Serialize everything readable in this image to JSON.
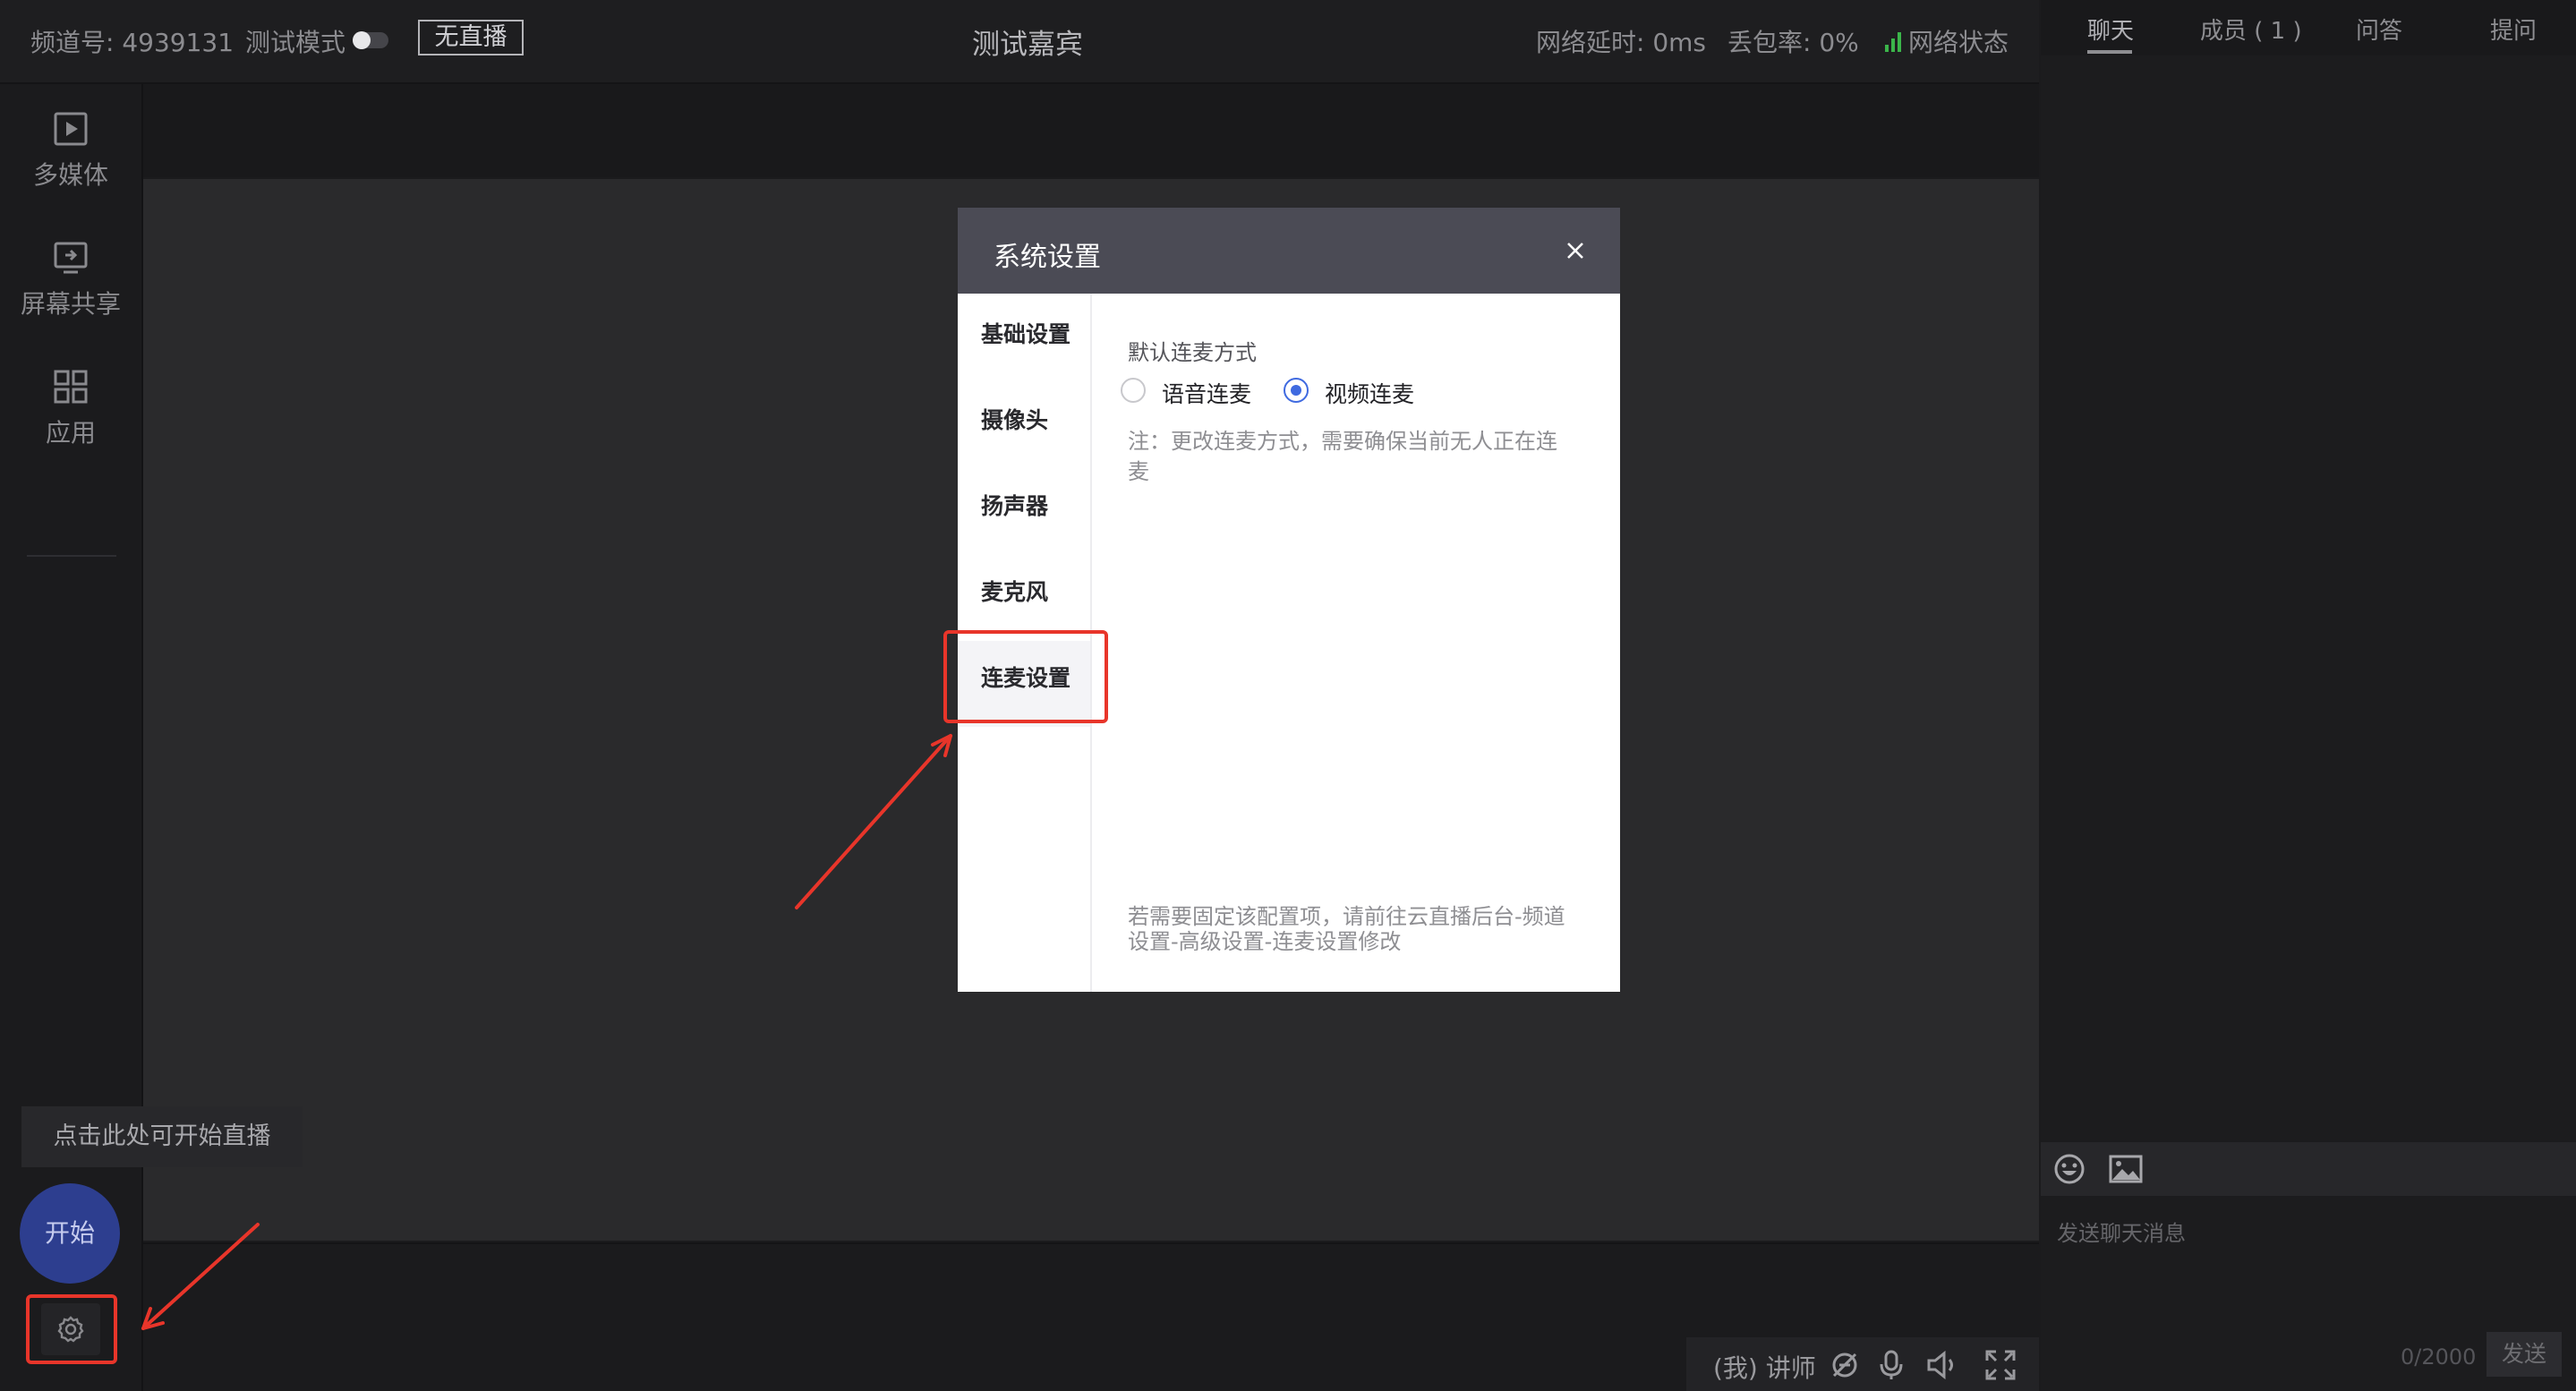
{
  "topbar": {
    "channel": "频道号: 4939131",
    "test_mode": "测试模式",
    "live_status": "无直播",
    "title": "测试嘉宾",
    "latency": "网络延时: 0ms",
    "packet_loss": "丢包率: 0%",
    "network_status": "网络状态"
  },
  "sidebar": {
    "items": [
      {
        "label": "多媒体",
        "icon": "play-icon"
      },
      {
        "label": "屏幕共享",
        "icon": "screen-share-icon"
      },
      {
        "label": "应用",
        "icon": "apps-grid-icon"
      }
    ]
  },
  "bottom_left": {
    "hint": "点击此处可开始直播",
    "start": "开始"
  },
  "controls": {
    "user": "(我) 讲师"
  },
  "right_panel": {
    "tabs": [
      "聊天",
      "成员 ( 1 )",
      "问答",
      "提问"
    ],
    "chat_placeholder": "发送聊天消息",
    "counter": "0/2000",
    "send": "发送"
  },
  "modal": {
    "title": "系统设置",
    "nav": [
      "基础设置",
      "摄像头",
      "扬声器",
      "麦克风",
      "连麦设置"
    ],
    "selected_nav": "连麦设置",
    "section_label": "默认连麦方式",
    "options": [
      {
        "label": "语音连麦",
        "selected": false
      },
      {
        "label": "视频连麦",
        "selected": true
      }
    ],
    "note": "注：更改连麦方式，需要确保当前无人正在连麦",
    "footer_note": "若需要固定该配置项，请前往云直播后台-频道设置-高级设置-连麦设置修改"
  },
  "colors": {
    "accent": "#3f6ae0",
    "annotation_red": "#e8352a",
    "start_button": "#2d3e8f",
    "signal_green": "#3bb54a"
  }
}
